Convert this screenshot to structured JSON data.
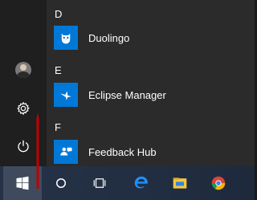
{
  "start_menu": {
    "sections": [
      {
        "letter": "D",
        "apps": [
          {
            "label": "Duolingo",
            "icon": "duolingo-owl-icon",
            "tile_color": "#0078d7"
          }
        ]
      },
      {
        "letter": "E",
        "apps": [
          {
            "label": "Eclipse Manager",
            "icon": "eclipse-manager-icon",
            "tile_color": "#0078d7"
          }
        ]
      },
      {
        "letter": "F",
        "apps": [
          {
            "label": "Feedback Hub",
            "icon": "feedback-hub-icon",
            "tile_color": "#0078d7"
          }
        ]
      }
    ],
    "rail": {
      "items": [
        {
          "icon": "user-avatar-icon"
        },
        {
          "icon": "gear-icon"
        },
        {
          "icon": "power-icon"
        }
      ]
    }
  },
  "taskbar": {
    "items": [
      {
        "icon": "windows-logo-icon"
      },
      {
        "icon": "cortana-circle-icon"
      },
      {
        "icon": "task-view-icon"
      },
      {
        "icon": "edge-browser-icon"
      },
      {
        "icon": "file-explorer-icon"
      },
      {
        "icon": "chrome-browser-icon"
      }
    ]
  },
  "colors": {
    "menu_bg": "#2b2b2b",
    "rail_bg": "#1f1f1f",
    "accent": "#0078d7",
    "taskbar_bg": "#1f2d45",
    "annotation_arrow": "#c00000"
  }
}
